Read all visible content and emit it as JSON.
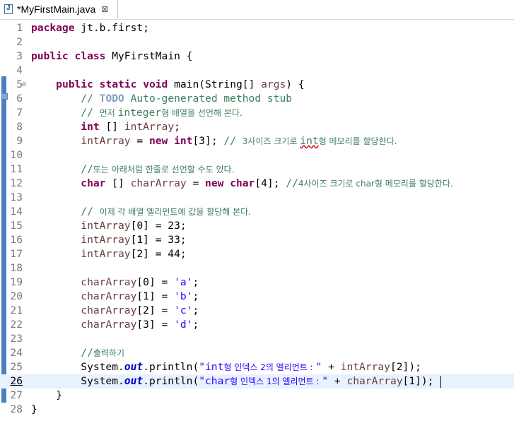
{
  "tab": {
    "title": "*MyFirstMain.java",
    "icon": "java-file-icon",
    "close_glyph": "⊠"
  },
  "lines": [
    {
      "n": "1",
      "tokens": [
        {
          "t": "kw",
          "v": "package"
        },
        {
          "t": "p",
          "v": " jt.b.first;"
        }
      ]
    },
    {
      "n": "2",
      "tokens": []
    },
    {
      "n": "3",
      "tokens": [
        {
          "t": "kw",
          "v": "public"
        },
        {
          "t": "p",
          "v": " "
        },
        {
          "t": "kw",
          "v": "class"
        },
        {
          "t": "p",
          "v": " MyFirstMain {"
        }
      ]
    },
    {
      "n": "4",
      "tokens": []
    },
    {
      "n": "5",
      "fold": "⊖",
      "tokens": [
        {
          "t": "p",
          "v": "    "
        },
        {
          "t": "kw",
          "v": "public"
        },
        {
          "t": "p",
          "v": " "
        },
        {
          "t": "kw",
          "v": "static"
        },
        {
          "t": "p",
          "v": " "
        },
        {
          "t": "kw",
          "v": "void"
        },
        {
          "t": "p",
          "v": " main(String[] "
        },
        {
          "t": "var",
          "v": "args"
        },
        {
          "t": "p",
          "v": ") {"
        }
      ]
    },
    {
      "n": "6",
      "tokens": [
        {
          "t": "p",
          "v": "        "
        },
        {
          "t": "cm",
          "v": "// "
        },
        {
          "t": "todo",
          "v": "TODO"
        },
        {
          "t": "cm",
          "v": " Auto-generated method stub"
        }
      ]
    },
    {
      "n": "7",
      "tokens": [
        {
          "t": "p",
          "v": "        "
        },
        {
          "t": "cm",
          "v": "// "
        },
        {
          "t": "cmko",
          "v": "먼저 "
        },
        {
          "t": "cm",
          "v": "integer"
        },
        {
          "t": "cmko",
          "v": "형 배열을 선언해 본다."
        }
      ]
    },
    {
      "n": "8",
      "tokens": [
        {
          "t": "p",
          "v": "        "
        },
        {
          "t": "kw",
          "v": "int"
        },
        {
          "t": "p",
          "v": " [] "
        },
        {
          "t": "var",
          "v": "intArray"
        },
        {
          "t": "p",
          "v": ";"
        }
      ]
    },
    {
      "n": "9",
      "tokens": [
        {
          "t": "p",
          "v": "        "
        },
        {
          "t": "var",
          "v": "intArray"
        },
        {
          "t": "p",
          "v": " = "
        },
        {
          "t": "kw",
          "v": "new"
        },
        {
          "t": "p",
          "v": " "
        },
        {
          "t": "kw",
          "v": "int"
        },
        {
          "t": "p",
          "v": "[3]; "
        },
        {
          "t": "cm",
          "v": "// "
        },
        {
          "t": "cmko",
          "v": "3사이즈 크기로 "
        },
        {
          "t": "cmsq",
          "v": "int"
        },
        {
          "t": "cmko",
          "v": "형 메모리를 할당한다."
        }
      ]
    },
    {
      "n": "10",
      "tokens": []
    },
    {
      "n": "11",
      "tokens": [
        {
          "t": "p",
          "v": "        "
        },
        {
          "t": "cm",
          "v": "//"
        },
        {
          "t": "cmko",
          "v": "또는 아래처럼 한줄로 선언할 수도 있다."
        }
      ]
    },
    {
      "n": "12",
      "tokens": [
        {
          "t": "p",
          "v": "        "
        },
        {
          "t": "kw",
          "v": "char"
        },
        {
          "t": "p",
          "v": " [] "
        },
        {
          "t": "var",
          "v": "charArray"
        },
        {
          "t": "p",
          "v": " = "
        },
        {
          "t": "kw",
          "v": "new"
        },
        {
          "t": "p",
          "v": " "
        },
        {
          "t": "kw",
          "v": "char"
        },
        {
          "t": "p",
          "v": "[4]; "
        },
        {
          "t": "cm",
          "v": "//"
        },
        {
          "t": "cmko",
          "v": "4사이즈 크기로 char형 메모리를 할당한다."
        }
      ]
    },
    {
      "n": "13",
      "tokens": []
    },
    {
      "n": "14",
      "tokens": [
        {
          "t": "p",
          "v": "        "
        },
        {
          "t": "cm",
          "v": "// "
        },
        {
          "t": "cmko",
          "v": "이제 각 배열 엘리먼트에 값을 할당해 본다."
        }
      ]
    },
    {
      "n": "15",
      "tokens": [
        {
          "t": "p",
          "v": "        "
        },
        {
          "t": "var",
          "v": "intArray"
        },
        {
          "t": "p",
          "v": "[0] = 23;"
        }
      ]
    },
    {
      "n": "16",
      "tokens": [
        {
          "t": "p",
          "v": "        "
        },
        {
          "t": "var",
          "v": "intArray"
        },
        {
          "t": "p",
          "v": "[1] = 33;"
        }
      ]
    },
    {
      "n": "17",
      "tokens": [
        {
          "t": "p",
          "v": "        "
        },
        {
          "t": "var",
          "v": "intArray"
        },
        {
          "t": "p",
          "v": "[2] = 44;"
        }
      ]
    },
    {
      "n": "18",
      "tokens": []
    },
    {
      "n": "19",
      "tokens": [
        {
          "t": "p",
          "v": "        "
        },
        {
          "t": "var",
          "v": "charArray"
        },
        {
          "t": "p",
          "v": "[0] = "
        },
        {
          "t": "str",
          "v": "'a'"
        },
        {
          "t": "p",
          "v": ";"
        }
      ]
    },
    {
      "n": "20",
      "tokens": [
        {
          "t": "p",
          "v": "        "
        },
        {
          "t": "var",
          "v": "charArray"
        },
        {
          "t": "p",
          "v": "[1] = "
        },
        {
          "t": "str",
          "v": "'b'"
        },
        {
          "t": "p",
          "v": ";"
        }
      ]
    },
    {
      "n": "21",
      "tokens": [
        {
          "t": "p",
          "v": "        "
        },
        {
          "t": "var",
          "v": "charArray"
        },
        {
          "t": "p",
          "v": "[2] = "
        },
        {
          "t": "str",
          "v": "'c'"
        },
        {
          "t": "p",
          "v": ";"
        }
      ]
    },
    {
      "n": "22",
      "tokens": [
        {
          "t": "p",
          "v": "        "
        },
        {
          "t": "var",
          "v": "charArray"
        },
        {
          "t": "p",
          "v": "[3] = "
        },
        {
          "t": "str",
          "v": "'d'"
        },
        {
          "t": "p",
          "v": ";"
        }
      ]
    },
    {
      "n": "23",
      "tokens": []
    },
    {
      "n": "24",
      "tokens": [
        {
          "t": "p",
          "v": "        "
        },
        {
          "t": "cm",
          "v": "//"
        },
        {
          "t": "cmko",
          "v": "출력하기"
        }
      ]
    },
    {
      "n": "25",
      "tokens": [
        {
          "t": "p",
          "v": "        System."
        },
        {
          "t": "fld",
          "v": "out"
        },
        {
          "t": "p",
          "v": ".println("
        },
        {
          "t": "str",
          "v": "\"int"
        },
        {
          "t": "strko",
          "v": "형 인덱스 2의 엘리먼트 : "
        },
        {
          "t": "str",
          "v": "\""
        },
        {
          "t": "p",
          "v": " + "
        },
        {
          "t": "var",
          "v": "intArray"
        },
        {
          "t": "p",
          "v": "[2]);"
        }
      ]
    },
    {
      "n": "26",
      "current": true,
      "tokens": [
        {
          "t": "p",
          "v": "        System."
        },
        {
          "t": "fld",
          "v": "out"
        },
        {
          "t": "p",
          "v": ".println("
        },
        {
          "t": "str",
          "v": "\"char"
        },
        {
          "t": "strko",
          "v": "형 인덱스 1의 엘리먼트 : "
        },
        {
          "t": "str",
          "v": "\""
        },
        {
          "t": "p",
          "v": " + "
        },
        {
          "t": "var",
          "v": "charArray"
        },
        {
          "t": "p",
          "v": "[1]);"
        }
      ]
    },
    {
      "n": "27",
      "tokens": [
        {
          "t": "p",
          "v": "    }"
        }
      ]
    },
    {
      "n": "28",
      "tokens": [
        {
          "t": "p",
          "v": "}"
        }
      ]
    }
  ],
  "colors": {
    "keyword": "#7f0055",
    "comment": "#3f7f5f",
    "string": "#2a00ff",
    "variable": "#6a3e3e",
    "field": "#0000c0",
    "current_line": "#e8f2fe"
  }
}
